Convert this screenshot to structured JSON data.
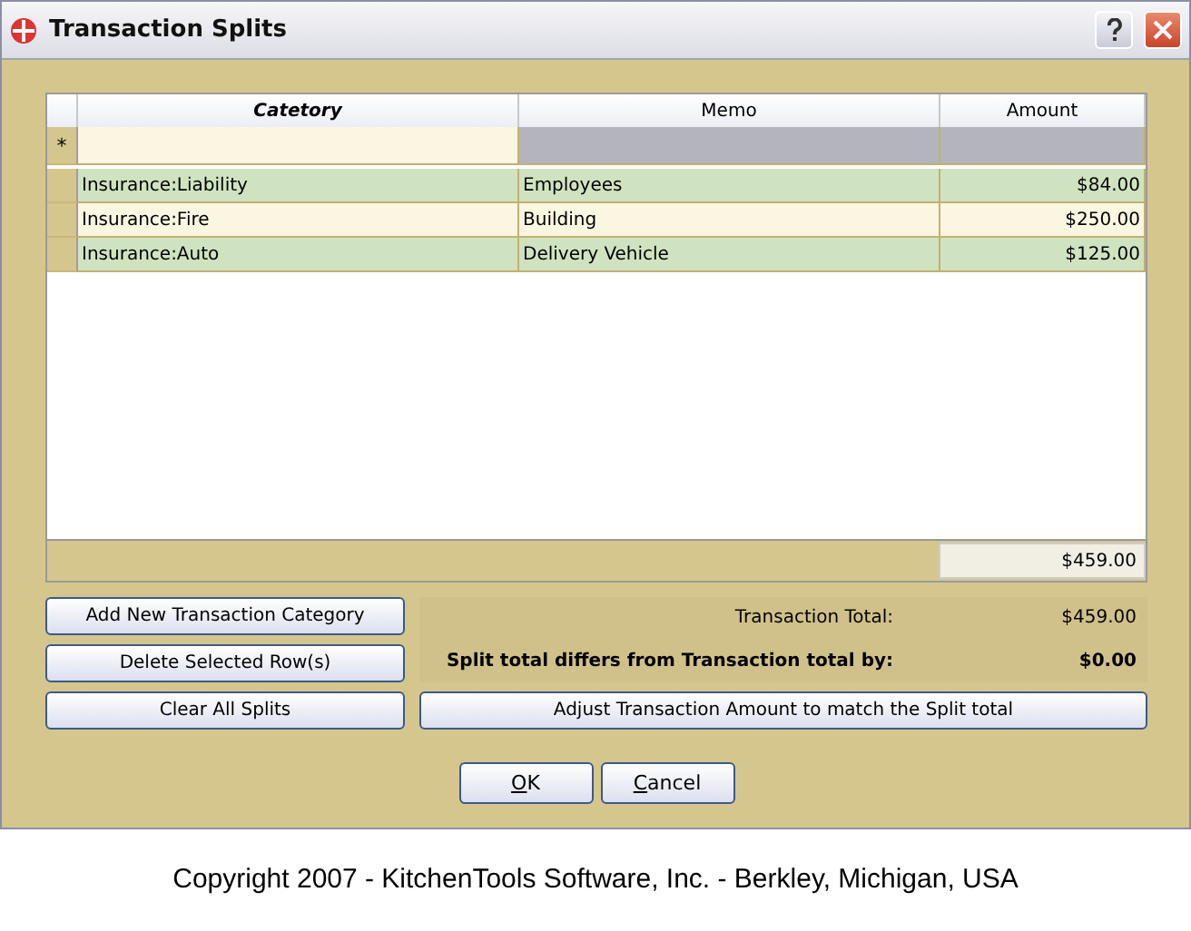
{
  "window": {
    "title": "Transaction Splits"
  },
  "table": {
    "columns": [
      "Catetory",
      "Memo",
      "Amount"
    ],
    "new_row_marker": "*",
    "rows": [
      {
        "category": "Insurance:Liability",
        "memo": "Employees",
        "amount": "$84.00"
      },
      {
        "category": "Insurance:Fire",
        "memo": "Building",
        "amount": "$250.00"
      },
      {
        "category": "Insurance:Auto",
        "memo": "Delivery Vehicle",
        "amount": "$125.00"
      }
    ],
    "footer_total": "$459.00"
  },
  "actions": [
    "Add New Transaction Category",
    "Delete Selected Row(s)",
    "Clear All Splits"
  ],
  "summary": {
    "transaction_total_label": "Transaction Total:",
    "transaction_total": "$459.00",
    "difference_label": "Split total differs from Transaction total by:",
    "difference": "$0.00"
  },
  "adjust_button": "Adjust Transaction Amount to match the Split total",
  "dialog_buttons": [
    "OK",
    "Cancel"
  ],
  "copyright": "Copyright 2007 - KitchenTools Software, Inc. - Berkley, Michigan, USA"
}
